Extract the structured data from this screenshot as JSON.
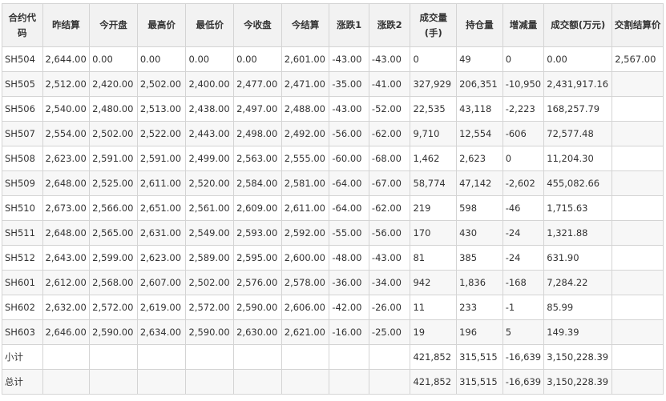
{
  "headers": [
    "合约代码",
    "昨结算",
    "今开盘",
    "最高价",
    "最低价",
    "今收盘",
    "今结算",
    "涨跌1",
    "涨跌2",
    "成交量(手)",
    "持仓量",
    "增减量",
    "成交额(万元)",
    "交割结算价"
  ],
  "rows": [
    [
      "SH504",
      "2,644.00",
      "0.00",
      "0.00",
      "0.00",
      "0.00",
      "2,601.00",
      "-43.00",
      "-43.00",
      "0",
      "49",
      "0",
      "0.00",
      "2,567.00"
    ],
    [
      "SH505",
      "2,512.00",
      "2,420.00",
      "2,502.00",
      "2,400.00",
      "2,477.00",
      "2,471.00",
      "-35.00",
      "-41.00",
      "327,929",
      "206,351",
      "-10,950",
      "2,431,917.16",
      ""
    ],
    [
      "SH506",
      "2,540.00",
      "2,480.00",
      "2,513.00",
      "2,438.00",
      "2,497.00",
      "2,488.00",
      "-43.00",
      "-52.00",
      "22,535",
      "43,118",
      "-2,223",
      "168,257.79",
      ""
    ],
    [
      "SH507",
      "2,554.00",
      "2,502.00",
      "2,522.00",
      "2,443.00",
      "2,498.00",
      "2,492.00",
      "-56.00",
      "-62.00",
      "9,710",
      "12,554",
      "-606",
      "72,577.48",
      ""
    ],
    [
      "SH508",
      "2,623.00",
      "2,591.00",
      "2,591.00",
      "2,499.00",
      "2,563.00",
      "2,555.00",
      "-60.00",
      "-68.00",
      "1,462",
      "2,623",
      "0",
      "11,204.30",
      ""
    ],
    [
      "SH509",
      "2,648.00",
      "2,525.00",
      "2,611.00",
      "2,520.00",
      "2,584.00",
      "2,581.00",
      "-64.00",
      "-67.00",
      "58,774",
      "47,142",
      "-2,602",
      "455,082.66",
      ""
    ],
    [
      "SH510",
      "2,673.00",
      "2,566.00",
      "2,651.00",
      "2,561.00",
      "2,609.00",
      "2,611.00",
      "-64.00",
      "-62.00",
      "219",
      "598",
      "-46",
      "1,715.63",
      ""
    ],
    [
      "SH511",
      "2,648.00",
      "2,565.00",
      "2,631.00",
      "2,549.00",
      "2,593.00",
      "2,592.00",
      "-55.00",
      "-56.00",
      "170",
      "430",
      "-24",
      "1,321.88",
      ""
    ],
    [
      "SH512",
      "2,643.00",
      "2,599.00",
      "2,623.00",
      "2,589.00",
      "2,595.00",
      "2,600.00",
      "-48.00",
      "-43.00",
      "81",
      "385",
      "-24",
      "631.90",
      ""
    ],
    [
      "SH601",
      "2,612.00",
      "2,568.00",
      "2,607.00",
      "2,502.00",
      "2,576.00",
      "2,578.00",
      "-36.00",
      "-34.00",
      "942",
      "1,836",
      "-168",
      "7,284.22",
      ""
    ],
    [
      "SH602",
      "2,632.00",
      "2,572.00",
      "2,619.00",
      "2,572.00",
      "2,590.00",
      "2,606.00",
      "-42.00",
      "-26.00",
      "11",
      "233",
      "-1",
      "85.99",
      ""
    ],
    [
      "SH603",
      "2,646.00",
      "2,590.00",
      "2,634.00",
      "2,590.00",
      "2,630.00",
      "2,621.00",
      "-16.00",
      "-25.00",
      "19",
      "196",
      "5",
      "149.39",
      ""
    ],
    [
      "小计",
      "",
      "",
      "",
      "",
      "",
      "",
      "",
      "",
      "421,852",
      "315,515",
      "-16,639",
      "3,150,228.39",
      ""
    ],
    [
      "总计",
      "",
      "",
      "",
      "",
      "",
      "",
      "",
      "",
      "421,852",
      "315,515",
      "-16,639",
      "3,150,228.39",
      ""
    ]
  ]
}
